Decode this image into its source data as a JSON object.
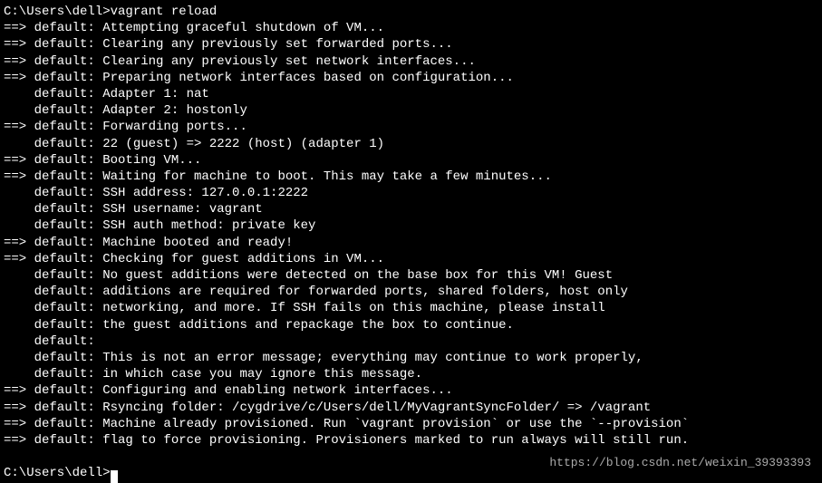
{
  "terminal": {
    "prompt1": "C:\\Users\\dell>",
    "command": "vagrant reload",
    "lines": [
      "==> default: Attempting graceful shutdown of VM...",
      "==> default: Clearing any previously set forwarded ports...",
      "==> default: Clearing any previously set network interfaces...",
      "==> default: Preparing network interfaces based on configuration...",
      "    default: Adapter 1: nat",
      "    default: Adapter 2: hostonly",
      "==> default: Forwarding ports...",
      "    default: 22 (guest) => 2222 (host) (adapter 1)",
      "==> default: Booting VM...",
      "==> default: Waiting for machine to boot. This may take a few minutes...",
      "    default: SSH address: 127.0.0.1:2222",
      "    default: SSH username: vagrant",
      "    default: SSH auth method: private key",
      "==> default: Machine booted and ready!",
      "==> default: Checking for guest additions in VM...",
      "    default: No guest additions were detected on the base box for this VM! Guest",
      "    default: additions are required for forwarded ports, shared folders, host only",
      "    default: networking, and more. If SSH fails on this machine, please install",
      "    default: the guest additions and repackage the box to continue.",
      "    default:",
      "    default: This is not an error message; everything may continue to work properly,",
      "    default: in which case you may ignore this message.",
      "==> default: Configuring and enabling network interfaces...",
      "==> default: Rsyncing folder: /cygdrive/c/Users/dell/MyVagrantSyncFolder/ => /vagrant",
      "==> default: Machine already provisioned. Run `vagrant provision` or use the `--provision`",
      "==> default: flag to force provisioning. Provisioners marked to run always will still run."
    ],
    "prompt2": "C:\\Users\\dell>"
  },
  "watermark": "https://blog.csdn.net/weixin_39393393"
}
